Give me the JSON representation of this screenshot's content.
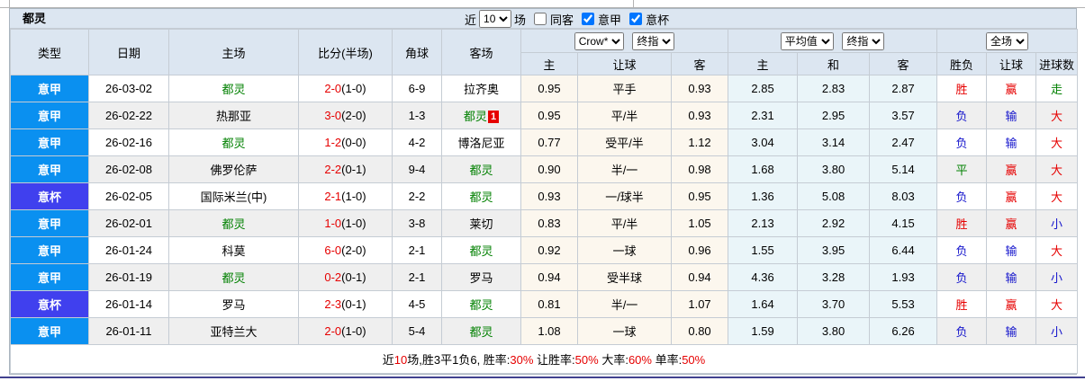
{
  "title": "都灵",
  "controls": {
    "recent_label": "近",
    "matches_select": "10",
    "matches_label": "场",
    "same_away_label": "同客",
    "serie_a_label": "意甲",
    "coppa_label": "意杯",
    "serie_a_checked": "true",
    "coppa_checked": "true"
  },
  "header": {
    "type": "类型",
    "date": "日期",
    "home": "主场",
    "score": "比分(半场)",
    "corner": "角球",
    "away": "客场",
    "ah_company_select": "Crow*",
    "ah_time_select": "终指",
    "eu_company_select": "平均值",
    "eu_time_select": "终指",
    "result_scope_select": "全场",
    "sub": [
      "主",
      "让球",
      "客",
      "主",
      "和",
      "客",
      "胜负",
      "让球",
      "进球数"
    ]
  },
  "result_colors": {
    "胜": "#e60000",
    "负": "#1515cc",
    "平": "#008000",
    "赢": "#e60000",
    "输": "#1515cc",
    "大": "#e60000",
    "小": "#1515cc",
    "走": "#008000"
  },
  "rows": [
    {
      "lt": "jia",
      "league": "意甲",
      "date": "26-03-02",
      "home": "都灵",
      "hg": true,
      "ft": "2-0",
      "ht": "(1-0)",
      "corner": "6-9",
      "away": "拉齐奥",
      "ag": false,
      "badge": "",
      "ah": [
        "0.95",
        "平手",
        "0.93"
      ],
      "eu": [
        "2.85",
        "2.83",
        "2.87"
      ],
      "res": [
        "胜",
        "赢",
        "走"
      ]
    },
    {
      "lt": "jia",
      "league": "意甲",
      "date": "26-02-22",
      "home": "热那亚",
      "hg": false,
      "ft": "3-0",
      "ht": "(2-0)",
      "corner": "1-3",
      "away": "都灵",
      "ag": true,
      "badge": "1",
      "ah": [
        "0.95",
        "平/半",
        "0.93"
      ],
      "eu": [
        "2.31",
        "2.95",
        "3.57"
      ],
      "res": [
        "负",
        "输",
        "大"
      ]
    },
    {
      "lt": "jia",
      "league": "意甲",
      "date": "26-02-16",
      "home": "都灵",
      "hg": true,
      "ft": "1-2",
      "ht": "(0-0)",
      "corner": "4-2",
      "away": "博洛尼亚",
      "ag": false,
      "badge": "",
      "ah": [
        "0.77",
        "受平/半",
        "1.12"
      ],
      "eu": [
        "3.04",
        "3.14",
        "2.47"
      ],
      "res": [
        "负",
        "输",
        "大"
      ]
    },
    {
      "lt": "jia",
      "league": "意甲",
      "date": "26-02-08",
      "home": "佛罗伦萨",
      "hg": false,
      "ft": "2-2",
      "ht": "(0-1)",
      "corner": "9-4",
      "away": "都灵",
      "ag": true,
      "badge": "",
      "ah": [
        "0.90",
        "半/一",
        "0.98"
      ],
      "eu": [
        "1.68",
        "3.80",
        "5.14"
      ],
      "res": [
        "平",
        "赢",
        "大"
      ]
    },
    {
      "lt": "bei",
      "league": "意杯",
      "date": "26-02-05",
      "home": "国际米兰(中)",
      "hg": false,
      "ft": "2-1",
      "ht": "(1-0)",
      "corner": "2-2",
      "away": "都灵",
      "ag": true,
      "badge": "",
      "ah": [
        "0.93",
        "一/球半",
        "0.95"
      ],
      "eu": [
        "1.36",
        "5.08",
        "8.03"
      ],
      "res": [
        "负",
        "赢",
        "大"
      ]
    },
    {
      "lt": "jia",
      "league": "意甲",
      "date": "26-02-01",
      "home": "都灵",
      "hg": true,
      "ft": "1-0",
      "ht": "(1-0)",
      "corner": "3-8",
      "away": "莱切",
      "ag": false,
      "badge": "",
      "ah": [
        "0.83",
        "平/半",
        "1.05"
      ],
      "eu": [
        "2.13",
        "2.92",
        "4.15"
      ],
      "res": [
        "胜",
        "赢",
        "小"
      ]
    },
    {
      "lt": "jia",
      "league": "意甲",
      "date": "26-01-24",
      "home": "科莫",
      "hg": false,
      "ft": "6-0",
      "ht": "(2-0)",
      "corner": "2-1",
      "away": "都灵",
      "ag": true,
      "badge": "",
      "ah": [
        "0.92",
        "一球",
        "0.96"
      ],
      "eu": [
        "1.55",
        "3.95",
        "6.44"
      ],
      "res": [
        "负",
        "输",
        "大"
      ]
    },
    {
      "lt": "jia",
      "league": "意甲",
      "date": "26-01-19",
      "home": "都灵",
      "hg": true,
      "ft": "0-2",
      "ht": "(0-1)",
      "corner": "2-1",
      "away": "罗马",
      "ag": false,
      "badge": "",
      "ah": [
        "0.94",
        "受半球",
        "0.94"
      ],
      "eu": [
        "4.36",
        "3.28",
        "1.93"
      ],
      "res": [
        "负",
        "输",
        "小"
      ]
    },
    {
      "lt": "bei",
      "league": "意杯",
      "date": "26-01-14",
      "home": "罗马",
      "hg": false,
      "ft": "2-3",
      "ht": "(0-1)",
      "corner": "4-5",
      "away": "都灵",
      "ag": true,
      "badge": "",
      "ah": [
        "0.81",
        "半/一",
        "1.07"
      ],
      "eu": [
        "1.64",
        "3.70",
        "5.53"
      ],
      "res": [
        "胜",
        "赢",
        "大"
      ]
    },
    {
      "lt": "jia",
      "league": "意甲",
      "date": "26-01-11",
      "home": "亚特兰大",
      "hg": false,
      "ft": "2-0",
      "ht": "(1-0)",
      "corner": "5-4",
      "away": "都灵",
      "ag": true,
      "badge": "",
      "ah": [
        "1.08",
        "一球",
        "0.80"
      ],
      "eu": [
        "1.59",
        "3.80",
        "6.26"
      ],
      "res": [
        "负",
        "输",
        "小"
      ]
    }
  ],
  "footer": {
    "segments": [
      {
        "t": "近",
        "c": "k"
      },
      {
        "t": "10",
        "c": "r"
      },
      {
        "t": "场,胜3平1负6, 胜率:",
        "c": "k"
      },
      {
        "t": "30%",
        "c": "r"
      },
      {
        "t": " 让胜率:",
        "c": "k"
      },
      {
        "t": "50%",
        "c": "r"
      },
      {
        "t": " 大率:",
        "c": "k"
      },
      {
        "t": "60%",
        "c": "r"
      },
      {
        "t": " 单率:",
        "c": "k"
      },
      {
        "t": "50%",
        "c": "r"
      }
    ]
  }
}
